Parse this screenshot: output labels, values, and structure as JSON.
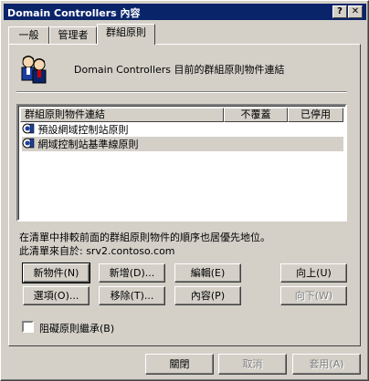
{
  "window": {
    "title": "Domain Controllers 內容",
    "help_btn": "?",
    "close_btn": "✕"
  },
  "tabs": [
    {
      "label": "一般",
      "active": false
    },
    {
      "label": "管理者",
      "active": false
    },
    {
      "label": "群組原則",
      "active": true
    }
  ],
  "header": {
    "icon": "users-icon",
    "text": "Domain Controllers 目前的群組原則物件連結"
  },
  "list": {
    "columns": [
      "群組原則物件連結",
      "不覆蓋",
      "已停用"
    ],
    "rows": [
      {
        "name": "預設網域控制站原則",
        "icon": "gpo-icon",
        "selected": false
      },
      {
        "name": "網域控制站基準線原則",
        "icon": "gpo-icon",
        "selected": true
      }
    ]
  },
  "info": {
    "line1": "在清單中排較前面的群組原則物件的順序也居優先地位。",
    "line2": "此清單來自於: srv2.contoso.com"
  },
  "buttons": {
    "new": "新物件(N)",
    "add": "新增(D)...",
    "edit": "編輯(E)",
    "up": "向上(U)",
    "options": "選項(O)...",
    "remove": "移除(T)...",
    "properties": "內容(P)",
    "down": "向下(W)"
  },
  "block": {
    "label": "阻礙原則繼承(B)",
    "checked": false
  },
  "footer": {
    "close": "關閉",
    "cancel": "取消",
    "apply": "套用(A)"
  }
}
